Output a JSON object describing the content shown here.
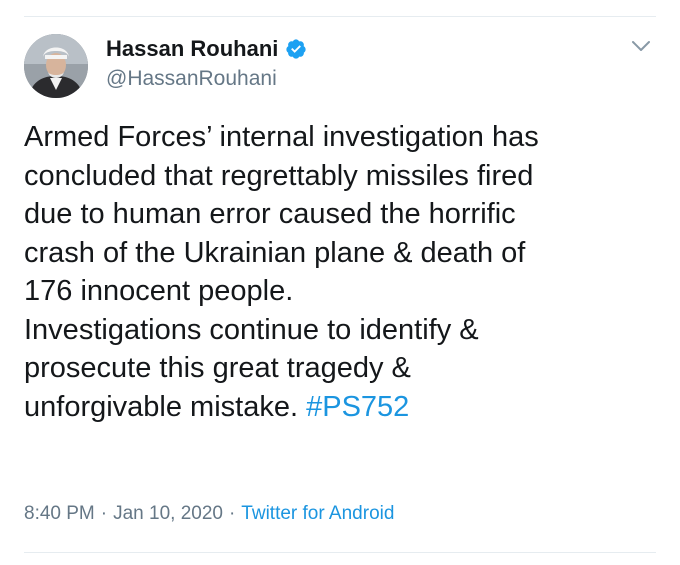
{
  "author": {
    "display_name": "Hassan Rouhani",
    "handle": "@HassanRouhani",
    "verified": true
  },
  "tweet": {
    "lines": [
      "Armed Forces’ internal investigation has",
      "concluded that regrettably missiles fired",
      "due to human error caused the horrific",
      "crash of the Ukrainian plane & death of",
      "176 innocent people.",
      "Investigations continue to identify &",
      "prosecute this great tragedy &",
      "unforgivable mistake."
    ],
    "hashtag": "#PS752"
  },
  "meta": {
    "time": "8:40 PM",
    "separator": "·",
    "date": "Jan 10, 2020",
    "source": "Twitter for Android"
  },
  "colors": {
    "link": "#1b95e0",
    "text": "#14171a",
    "muted": "#657786",
    "verified": "#1da1f2"
  },
  "icons": {
    "verified": "verified-badge-icon",
    "menu": "chevron-down-icon"
  }
}
